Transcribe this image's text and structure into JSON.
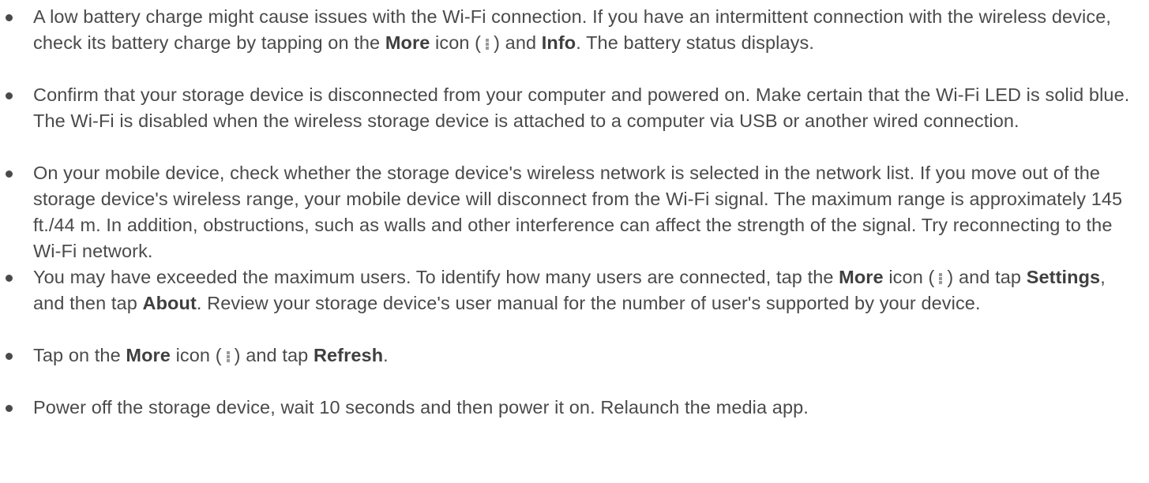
{
  "tips": [
    {
      "parts": [
        {
          "t": "A low battery charge might cause issues with the Wi-Fi connection. If you have an intermittent connection with the wireless device, check its battery charge by tapping on the "
        },
        {
          "b": "More"
        },
        {
          "t": " icon ("
        },
        {
          "icon": "more-icon"
        },
        {
          "t": ") and "
        },
        {
          "b": "Info"
        },
        {
          "t": ". The battery status displays."
        }
      ]
    },
    {
      "parts": [
        {
          "t": "Confirm that your storage device is disconnected from your computer and powered on. Make certain that the Wi-Fi LED is solid blue. The Wi-Fi is disabled when the wireless storage device is attached to a computer via USB or another wired connection."
        }
      ]
    },
    {
      "parts": [
        {
          "t": "On your mobile device, check whether the storage device's wireless network is selected in the network list. If you move out of the storage device's wireless range, your mobile device will disconnect from the Wi-Fi signal. The maximum range is approximately 145 ft./44 m. In addition, obstructions, such as walls and other interference can affect the strength of the signal. Try reconnecting to the Wi-Fi network."
        }
      ]
    },
    {
      "parts": [
        {
          "t": "You may have exceeded the maximum users. To identify how many users are connected, tap the "
        },
        {
          "b": "More"
        },
        {
          "t": " icon ("
        },
        {
          "icon": "more-icon"
        },
        {
          "t": ") and tap "
        },
        {
          "b": "Settings"
        },
        {
          "t": ", and then tap "
        },
        {
          "b": "About"
        },
        {
          "t": ". Review your storage device's user manual for the number of user's supported by your device."
        }
      ]
    },
    {
      "parts": [
        {
          "t": "Tap on the "
        },
        {
          "b": "More"
        },
        {
          "t": " icon ("
        },
        {
          "icon": "more-icon"
        },
        {
          "t": ") and tap "
        },
        {
          "b": "Refresh"
        },
        {
          "t": "."
        }
      ]
    },
    {
      "parts": [
        {
          "t": "Power off the storage device, wait 10 seconds and then power it on. Relaunch the media app."
        }
      ]
    }
  ]
}
